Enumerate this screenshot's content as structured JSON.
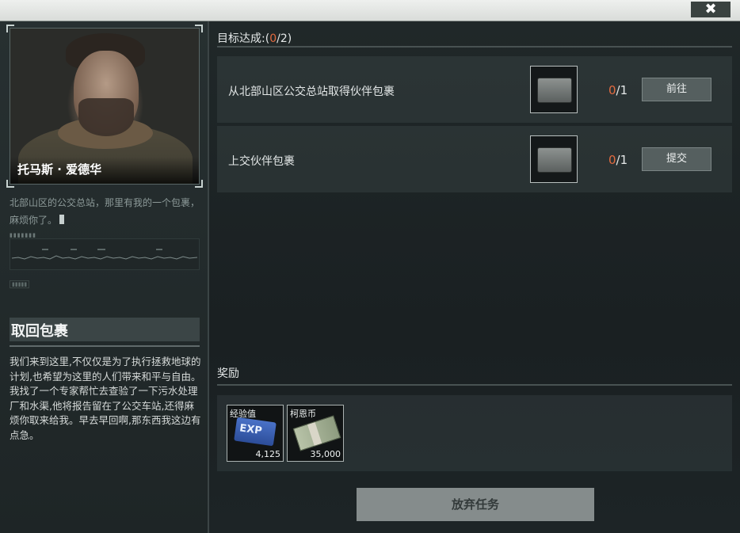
{
  "window": {
    "close_icon": "✖"
  },
  "npc": {
    "name": "托马斯 · 爱德华",
    "dialogue": "北部山区的公交总站，那里有我的一个包裹，麻烦你了。"
  },
  "quest": {
    "title": "取回包裹",
    "description": "我们来到这里,不仅仅是为了执行拯救地球的计划,也希望为这里的人们带来和平与自由。我找了一个专家帮忙去查验了一下污水处理厂和水渠,他将报告留在了公交车站,还得麻烦你取来给我。早去早回啊,那东西我这边有点急。"
  },
  "objectives": {
    "label_prefix": "目标达成:(",
    "done": "0",
    "separator": "/",
    "total": "2",
    "label_suffix": ")",
    "items": [
      {
        "text": "从北部山区公交总站取得伙伴包裹",
        "current": "0",
        "required": "/1",
        "button": "前往",
        "icon": "package-case-icon"
      },
      {
        "text": "上交伙伴包裹",
        "current": "0",
        "required": "/1",
        "button": "提交",
        "icon": "package-case-icon"
      }
    ]
  },
  "rewards": {
    "label": "奖励",
    "items": [
      {
        "name": "经验值",
        "value": "4,125",
        "icon": "exp-icon"
      },
      {
        "name": "柯恩币",
        "value": "35,000",
        "icon": "money-stack-icon"
      }
    ]
  },
  "footer": {
    "abandon_label": "放弃任务"
  },
  "colors": {
    "highlight": "#e26a3f",
    "button": "#555f5f",
    "abandon": "#858c8c"
  }
}
